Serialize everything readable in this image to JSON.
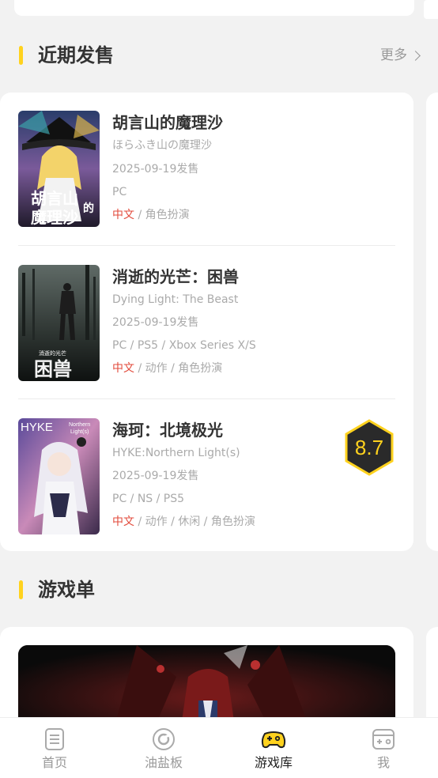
{
  "recent": {
    "title": "近期发售",
    "more_label": "更多",
    "games": [
      {
        "title": "胡言山的魔理沙",
        "subtitle": "ほらふき山の魔理沙",
        "release": "2025-09-19发售",
        "platforms": "PC",
        "tag_cn": "中文",
        "tags": " / 角色扮演",
        "cover_text_1": "胡言山",
        "cover_text_2": "的",
        "cover_text_3": "魔理沙"
      },
      {
        "title": "消逝的光芒：困兽",
        "subtitle": "Dying Light: The Beast",
        "release": "2025-09-19发售",
        "platforms": "PC / PS5 / Xbox Series X/S",
        "tag_cn": "中文",
        "tags": " / 动作 / 角色扮演",
        "cover_text_1": "消逝的光芒",
        "cover_text_2": "困兽"
      },
      {
        "title": "海珂：北境极光",
        "subtitle": "HYKE:Northern Light(s)",
        "release": "2025-09-19发售",
        "platforms": "PC / NS / PS5",
        "tag_cn": "中文",
        "tags": " / 动作 / 休闲 / 角色扮演",
        "score": "8.7",
        "cover_text_1": "HYKE",
        "cover_text_2": "Northern",
        "cover_text_3": "Light(s)"
      }
    ]
  },
  "playlist": {
    "title": "游戏单"
  },
  "nav": [
    {
      "label": "首页",
      "icon": "news-icon",
      "active": false
    },
    {
      "label": "油盐板",
      "icon": "disc-icon",
      "active": false
    },
    {
      "label": "游戏库",
      "icon": "gamepad-icon",
      "active": true
    },
    {
      "label": "我",
      "icon": "profile-console-icon",
      "active": false
    }
  ],
  "colors": {
    "accent": "#ffd21e",
    "tag_red": "#e24a3b",
    "background": "#f2f2f2"
  }
}
